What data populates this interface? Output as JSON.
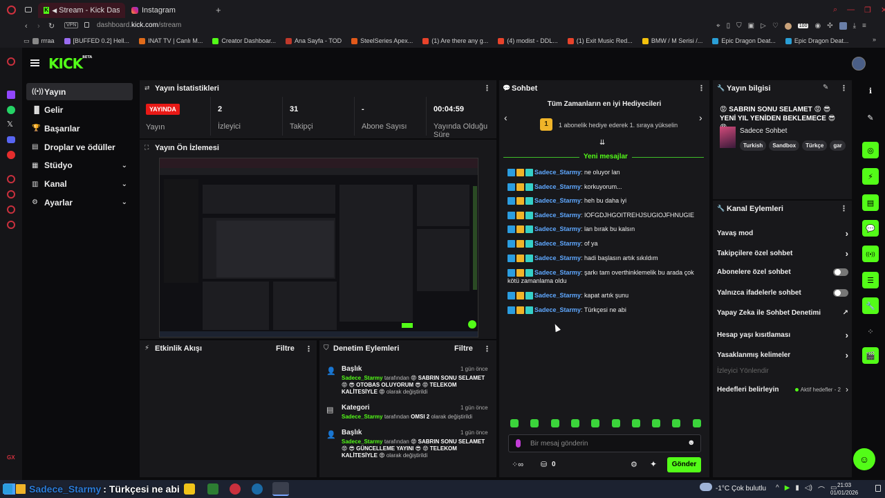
{
  "browser": {
    "tabs": [
      {
        "label": "Stream - Kick Dashbo"
      },
      {
        "label": "Instagram"
      }
    ],
    "vpn_label": "VPN",
    "url_host": "dashboard.",
    "url_domain": "kick.com",
    "url_path": "/stream",
    "extension_badge": "100",
    "bookmarks": [
      {
        "label": "rrraa",
        "color": "#888"
      },
      {
        "label": "[BUFFED 0.2] Hell...",
        "color": "#9a6cf0"
      },
      {
        "label": "INAT TV | Canlı M...",
        "color": "#e06b1a"
      },
      {
        "label": "Creator Dashboar...",
        "color": "#53fc18"
      },
      {
        "label": "Ana Sayfa - TOD",
        "color": "#c0392b"
      },
      {
        "label": "SteelSeries Apex...",
        "color": "#e2591a"
      },
      {
        "label": "(1) Are there any g...",
        "color": "#e8432b"
      },
      {
        "label": "(4) modist - DDL...",
        "color": "#e8432b"
      },
      {
        "label": "(1) Exit Music Red...",
        "color": "#e8432b"
      },
      {
        "label": "BMW / M Serisi /...",
        "color": "#f3c10d"
      },
      {
        "label": "Epic Dragon Deat...",
        "color": "#2a9fd6"
      },
      {
        "label": "Epic Dragon Deat...",
        "color": "#2a9fd6"
      }
    ]
  },
  "app": {
    "logo": "KICK",
    "logo_sup": "BETA",
    "nav": [
      {
        "label": "Yayın",
        "icon": "broadcast-icon"
      },
      {
        "label": "Gelir",
        "icon": "revenue-icon"
      },
      {
        "label": "Başarılar",
        "icon": "trophy-icon"
      },
      {
        "label": "Droplar ve ödüller",
        "icon": "gift-icon"
      },
      {
        "label": "Stüdyo",
        "icon": "studio-icon"
      },
      {
        "label": "Kanal",
        "icon": "channel-icon"
      },
      {
        "label": "Ayarlar",
        "icon": "settings-icon"
      }
    ]
  },
  "stats": {
    "title": "Yayın İstatistikleri",
    "live_badge": "YAYINDA",
    "live_label": "Yayın",
    "items": [
      {
        "value": "2",
        "label": "İzleyici"
      },
      {
        "value": "31",
        "label": "Takipçi"
      },
      {
        "value": "-",
        "label": "Abone Sayısı"
      },
      {
        "value": "00:04:59",
        "label": "Yayında Olduğu Süre"
      }
    ]
  },
  "preview": {
    "title": "Yayın Ön İzlemesi"
  },
  "activity": {
    "title": "Etkinlik Akışı",
    "filter": "Filtre"
  },
  "moderation": {
    "title": "Denetim Eylemleri",
    "filter": "Filtre",
    "items": [
      {
        "type": "Başlık",
        "time": "1 gün önce",
        "user": "Sadece_Starmy",
        "by": "tarafından",
        "text": "😡 SABRIN SONU SELAMET 😡 😎 OTOBAS OLUYORUM 😎 😡 TELEKOM KALİTESİYLE 😡",
        "suffix": "olarak değiştirildi"
      },
      {
        "type": "Kategori",
        "time": "1 gün önce",
        "user": "Sadece_Starmy",
        "by": "tarafından",
        "text": "OMSI 2",
        "suffix": "olarak değiştirildi"
      },
      {
        "type": "Başlık",
        "time": "1 gün önce",
        "user": "Sadece_Starmy",
        "by": "tarafından",
        "text": "😡 SABRIN SONU SELAMET 😡 😎 GÜNCELLEME YAYINI 😎 😡 TELEKOM KALİTESİYLE 😡",
        "suffix": "olarak değiştirildi"
      }
    ]
  },
  "chat": {
    "title": "Sohbet",
    "gifters_title": "Tüm Zamanların en iyi Hediyecileri",
    "gifters_rank": "1",
    "gifters_hint": "1 abonelik hediye ederek 1. sıraya yükselin",
    "new_messages": "Yeni mesajlar",
    "messages": [
      {
        "user": "Sadece_Starmy",
        "text": ": ne oluyor lan"
      },
      {
        "user": "Sadece_Starmy",
        "text": ": korkuyorum..."
      },
      {
        "user": "Sadece_Starmy",
        "text": ": heh bu daha iyi"
      },
      {
        "user": "Sadece_Starmy",
        "text": ": IOFGDJHGOITREHJSUGIOJFHNUGIE"
      },
      {
        "user": "Sadece_Starmy",
        "text": ": lan bırak bu kalsın"
      },
      {
        "user": "Sadece_Starmy",
        "text": ": of ya"
      },
      {
        "user": "Sadece_Starmy",
        "text": ": hadi başlasın artık sıkıldım"
      },
      {
        "user": "Sadece_Starmy",
        "text": ": şarkı tam overthinklemelik bu arada çok kötü zamanlama oldu"
      },
      {
        "user": "Sadece_Starmy",
        "text": ": kapat artık şunu"
      },
      {
        "user": "Sadece_Starmy",
        "text": ": Türkçesi ne abi"
      }
    ],
    "input_placeholder": "Bir mesaj gönderin",
    "points_value": "0",
    "send_label": "Gönder"
  },
  "stream_info": {
    "title": "Yayın bilgisi",
    "stream_title": "😡 SABRIN SONU SELAMET 😡 😎 YENİ YIL YENİDEN BEKLEMECE 😎 😡...",
    "category": "Sadece Sohbet",
    "tags": [
      "Turkish",
      "Sandbox",
      "Türkçe",
      "gar"
    ]
  },
  "channel_actions": {
    "title": "Kanal Eylemleri",
    "items": [
      {
        "label": "Yavaş mod"
      },
      {
        "label": "Takipçilere özel sohbet"
      },
      {
        "label": "Abonelere özel sohbet"
      },
      {
        "label": "Yalnızca ifadelerle sohbet"
      },
      {
        "label": "Yapay Zeka ile Sohbet Denetimi"
      },
      {
        "label": "Hesap yaşı kısıtlaması"
      },
      {
        "label": "Yasaklanmış kelimeler"
      },
      {
        "label": "İzleyici Yönlendir"
      },
      {
        "label": "Hedefleri belirleyin"
      }
    ],
    "goals_status": "Aktif hedefler - 2"
  },
  "overlay": {
    "user": "Sadece_Starmy",
    "text": ": Türkçesi ne abi"
  },
  "taskbar": {
    "weather": "-1°C",
    "weather_text": "Çok bulutlu",
    "time": "21:03",
    "date": "01/01/2026",
    "gx_label": "GX"
  },
  "colors": {
    "kick_green": "#53fc18",
    "live_red": "#e91916",
    "username_blue": "#5fa8ff"
  }
}
